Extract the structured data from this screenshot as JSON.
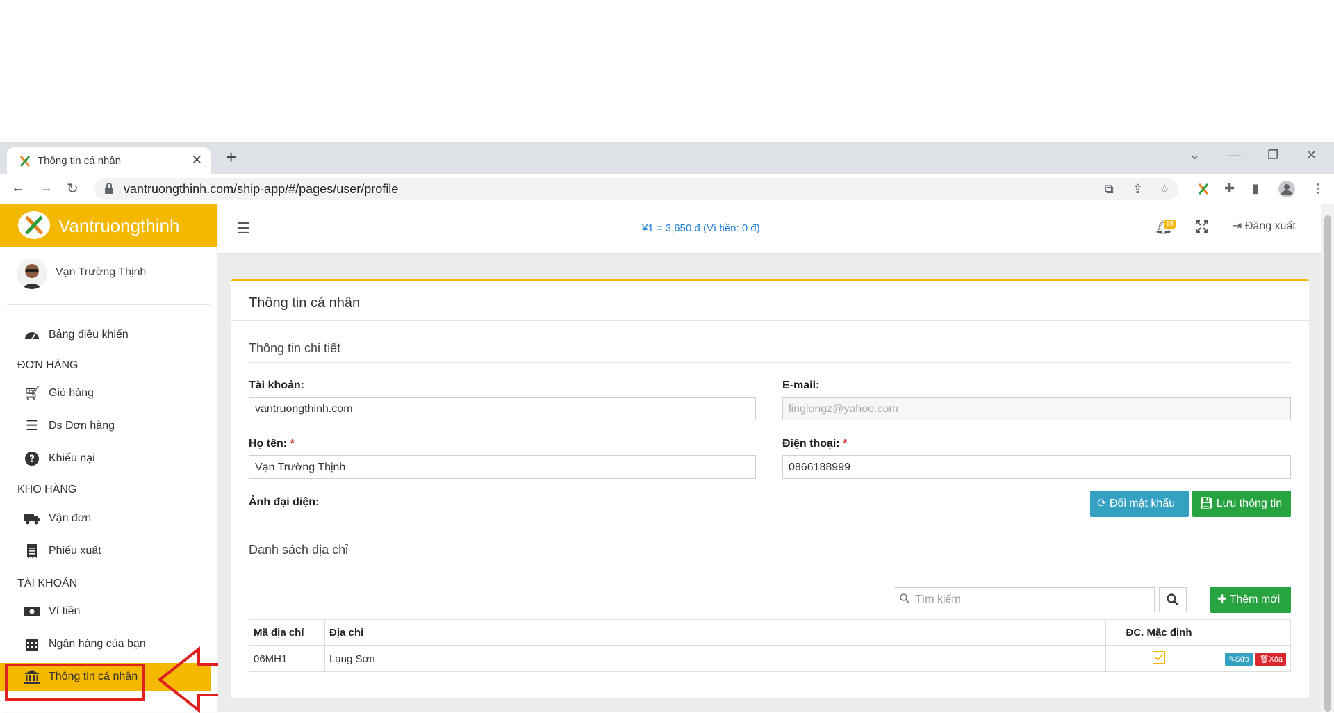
{
  "browser": {
    "tab_title": "Thông tin cá nhân",
    "url": "vantruongthinh.com/ship-app/#/pages/user/profile"
  },
  "sidebar": {
    "brand": "Vantruongthinh",
    "user_name": "Vạn Trường Thịnh",
    "sections": {
      "dashboard": "Bảng điều khiển",
      "orders_heading": "ĐƠN HÀNG",
      "cart": "Giỏ hàng",
      "order_list": "Ds Đơn hàng",
      "complaints": "Khiếu nại",
      "warehouse_heading": "KHO HÀNG",
      "waybill": "Vận đơn",
      "export_slip": "Phiếu xuất",
      "account_heading": "TÀI KHOẢN",
      "wallet": "Ví tiền",
      "bank": "Ngân hàng của bạn",
      "profile": "Thông tin cá nhân"
    }
  },
  "header": {
    "rate": "¥1 = 3,650 đ (Ví tiền: 0 đ)",
    "notification_count": "15",
    "logout": "Đăng xuất"
  },
  "profile": {
    "panel_title": "Thông tin cá nhân",
    "detail_title": "Thông tin chi tiết",
    "account_label": "Tài khoản:",
    "account_value": "vantruongthinh.com",
    "email_label": "E-mail:",
    "email_value": "linglongz@yahoo.com",
    "fullname_label": "Họ tên:",
    "fullname_value": "Vạn Trường Thịnh",
    "phone_label": "Điện thoại:",
    "phone_value": "0866188999",
    "required_mark": "*",
    "avatar_label": "Ảnh đại diện:",
    "change_password": "Đổi mật khẩu",
    "save_info": "Lưu thông tin"
  },
  "address": {
    "title": "Danh sách địa chỉ",
    "search_placeholder": "Tìm kiếm",
    "add_new": "Thêm mới",
    "columns": [
      "Mã địa chỉ",
      "Địa chỉ",
      "ĐC. Mặc định",
      ""
    ],
    "rows": [
      {
        "code": "06MH1",
        "address": "Lạng Sơn",
        "is_default": true,
        "edit": "Sửa",
        "delete": "Xóa"
      }
    ]
  },
  "colors": {
    "brand_yellow": "#f5b800",
    "info_blue": "#34a0c2",
    "success_green": "#27a33f",
    "danger_red": "#d9272e",
    "annotation_red": "#e01f1f"
  }
}
